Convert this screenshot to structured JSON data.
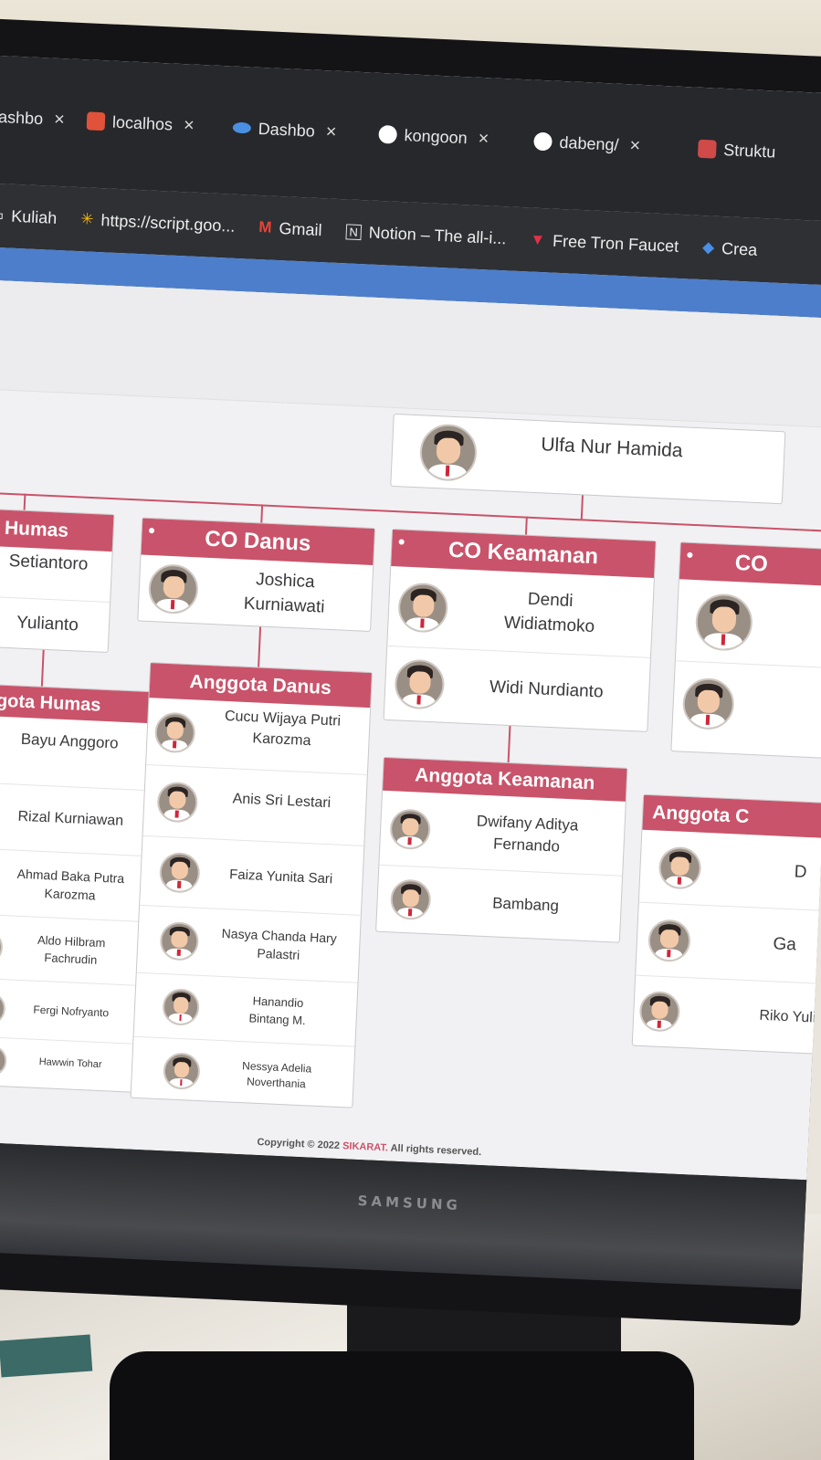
{
  "browser": {
    "tabs": [
      {
        "label": "Dashbo",
        "icon": "dashboard-icon",
        "color": "#3a3c40"
      },
      {
        "label": "localhos",
        "icon": "localhost-icon",
        "color": "#e0523a"
      },
      {
        "label": "Dashbo",
        "icon": "dashboard-icon",
        "color": "#4a90e2"
      },
      {
        "label": "kongoon",
        "icon": "github-icon",
        "color": "#ffffff"
      },
      {
        "label": "dabeng/",
        "icon": "github-icon",
        "color": "#ffffff"
      },
      {
        "label": "Struktu",
        "icon": "app-icon",
        "color": "#d04a4a"
      }
    ],
    "close_glyph": "×",
    "bookmarks": [
      {
        "label": "Kuliah",
        "icon": "folder-icon"
      },
      {
        "label": "https://script.goo...",
        "icon": "apps-script-icon"
      },
      {
        "label": "Gmail",
        "icon": "gmail-icon"
      },
      {
        "label": "Notion – The all-i...",
        "icon": "notion-icon"
      },
      {
        "label": "Free Tron Faucet",
        "icon": "tron-icon"
      },
      {
        "label": "Crea",
        "icon": "diamond-icon"
      }
    ]
  },
  "org": {
    "top": {
      "name": "Ulfa Nur Hamida"
    },
    "co_humas": {
      "title": "CO Humas",
      "members": [
        "Setiantoro",
        "Yulianto"
      ]
    },
    "co_danus": {
      "title": "CO Danus",
      "members": [
        "Joshica Kurniawati"
      ]
    },
    "co_keamanan": {
      "title": "CO Keamanan",
      "members": [
        "Dendi Widiatmoko",
        "Widi Nurdianto"
      ]
    },
    "co_partial": {
      "title": "CO"
    },
    "anggota_humas": {
      "title": "Anggota Humas",
      "members": [
        "Bayu Anggoro",
        "Rizal Kurniawan",
        "Ahmad Baka Putra Karozma",
        "Aldo Hilbram Fachrudin",
        "Fergi Nofryanto",
        "Hawwin Tohar"
      ]
    },
    "anggota_danus": {
      "title": "Anggota Danus",
      "members": [
        "Cucu Wijaya Putri Karozma",
        "Anis Sri Lestari",
        "Faiza Yunita Sari",
        "Nasya Chanda Hary Palastri",
        "Hanandio Bintang M.",
        "Nessya Adelia Noverthania"
      ]
    },
    "anggota_keamanan": {
      "title": "Anggota Keamanan",
      "members": [
        "Dwifany Aditya Fernando",
        "Bambang"
      ]
    },
    "anggota_partial": {
      "title": "Anggota C",
      "members": [
        "D",
        "Ga",
        "Riko Yulia"
      ]
    }
  },
  "footer": {
    "copyright": "Copyright © 2022",
    "brand": "SIKARAT.",
    "rights": "All rights reserved."
  },
  "monitor": {
    "brand": "SAMSUNG"
  },
  "colors": {
    "accent": "#c9536a",
    "topbar": "#4d7ecb",
    "tabbar": "#26282c"
  }
}
